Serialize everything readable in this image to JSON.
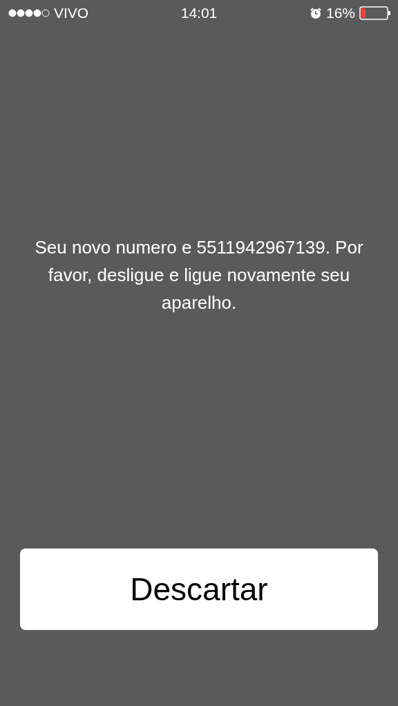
{
  "status_bar": {
    "carrier": "VIVO",
    "time": "14:01",
    "battery_percent": "16%"
  },
  "alert": {
    "message": "Seu novo numero e 5511942967139. Por favor, desligue e ligue novamente seu aparelho.",
    "buttons": [
      "Descartar"
    ]
  }
}
